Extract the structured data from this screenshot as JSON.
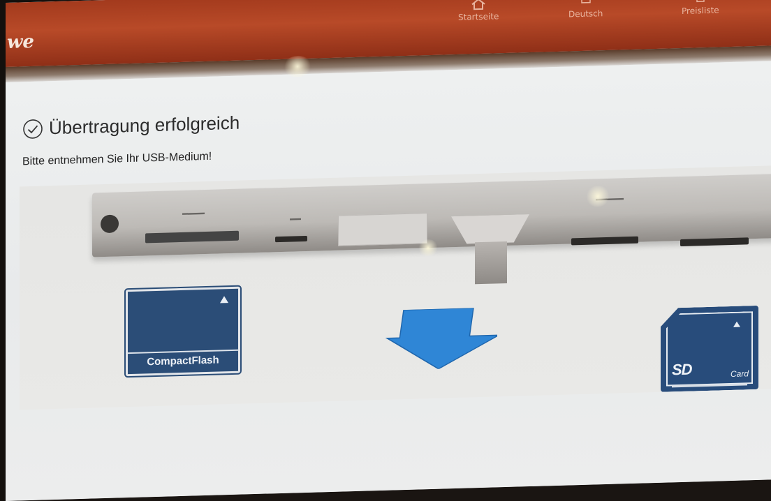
{
  "header": {
    "logo_text": "we",
    "nav": [
      {
        "label": "Startseite",
        "icon": "home-icon"
      },
      {
        "label": "Deutsch",
        "icon": "language-icon"
      },
      {
        "label": "Preisliste",
        "icon": "price-list-icon"
      }
    ]
  },
  "main": {
    "title": "Übertragung erfolgreich",
    "subtitle": "Bitte entnehmen Sie Ihr USB-Medium!",
    "status_icon": "check-circle-icon"
  },
  "illustration": {
    "cf_card_label": "CompactFlash",
    "sd_logo": "SD",
    "sd_card_word": "Card",
    "arrow_icon": "arrow-down-icon"
  },
  "colors": {
    "header": "#b84a28",
    "card_blue": "#2b4d77",
    "arrow_blue": "#2f86d6"
  }
}
